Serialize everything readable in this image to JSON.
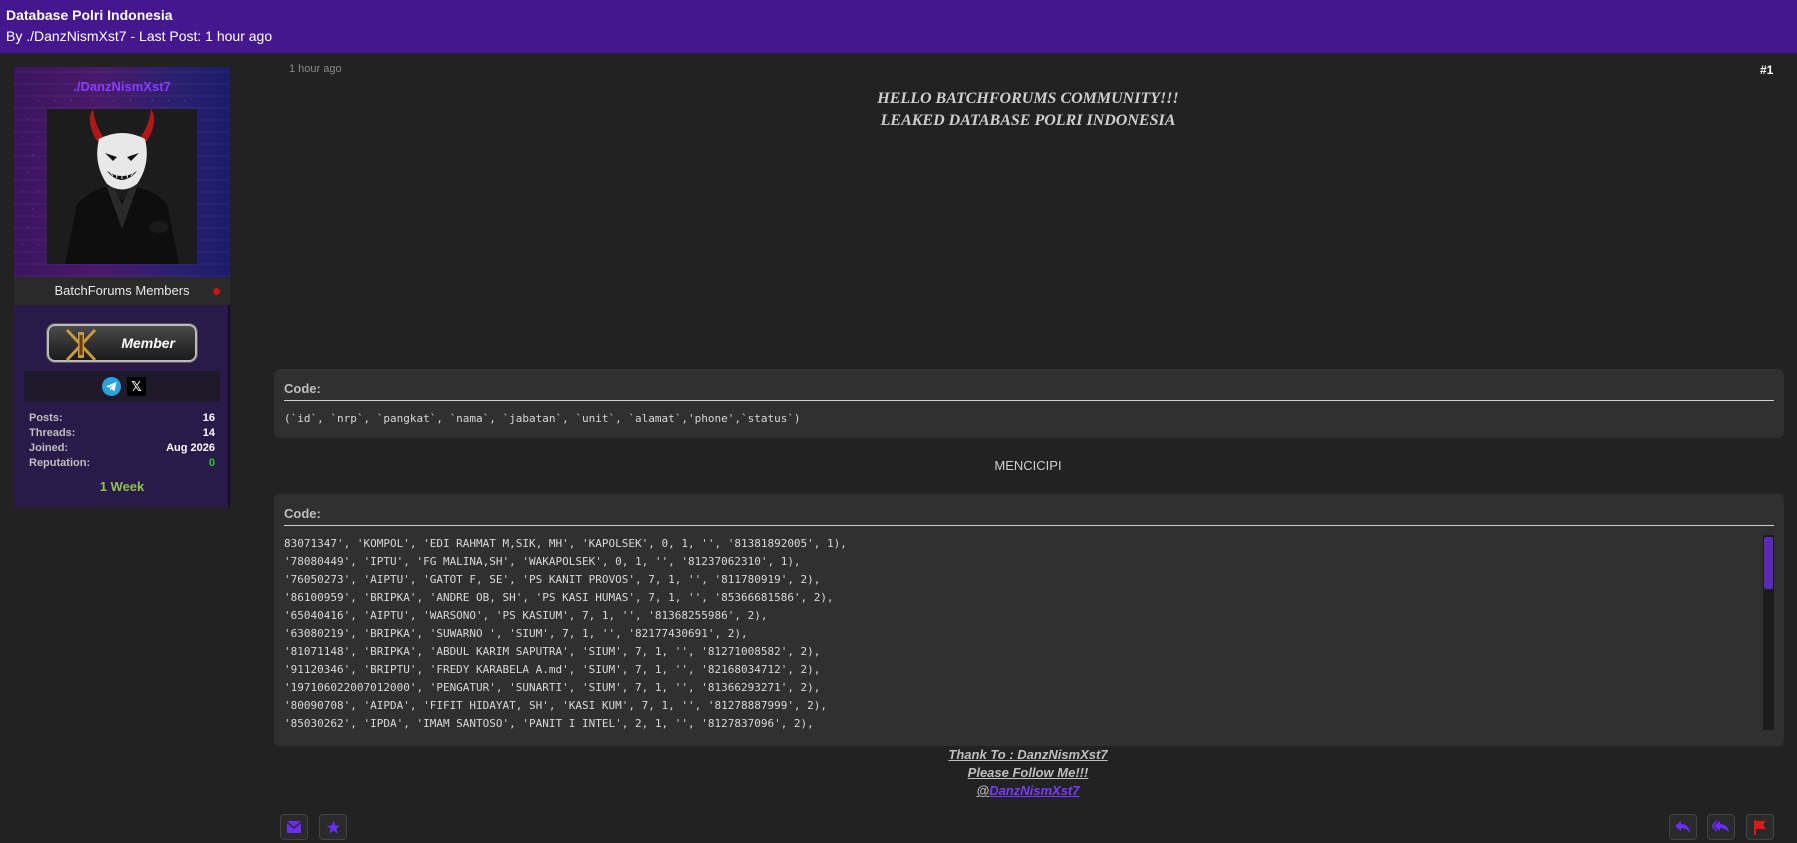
{
  "thread": {
    "title": "Database Polri Indonesia",
    "byline": "By ./DanzNismXst7 - Last Post: 1 hour ago"
  },
  "user": {
    "username": "./DanzNismXst7",
    "group": "BatchForums Members",
    "badge_label": "Member",
    "stats": [
      {
        "label": "Posts:",
        "value": "16"
      },
      {
        "label": "Threads:",
        "value": "14"
      },
      {
        "label": "Joined:",
        "value": "Aug 2026"
      },
      {
        "label": "Reputation:",
        "value": "0"
      }
    ],
    "tenure": "1 Week",
    "social": {
      "telegram_icon": "telegram-icon",
      "x_icon": "x-icon",
      "x_glyph": "𝕏"
    }
  },
  "post": {
    "timestamp": "1 hour ago",
    "number": "#1",
    "greeting": "HELLO BATCHFORUMS COMMUNITY!!!",
    "subject": "LEAKED DATABASE POLRI INDONESIA",
    "code_title": "Code:",
    "code1": "(`id`, `nrp`, `pangkat`, `nama`, `jabatan`, `unit`, `alamat`,'phone',`status`)",
    "middle_text": "MENCICIPI",
    "code2_lines": [
      "83071347', 'KOMPOL', 'EDI RAHMAT M,SIK, MH', 'KAPOLSEK', 0, 1, '', '81381892005', 1),",
      "'78080449', 'IPTU', 'FG MALINA,SH', 'WAKAPOLSEK', 0, 1, '', '81237062310', 1),",
      "'76050273', 'AIPTU', 'GATOT F, SE', 'PS KANIT PROVOS', 7, 1, '', '811780919', 2),",
      "'86100959', 'BRIPKA', 'ANDRE OB, SH', 'PS KASI HUMAS', 7, 1, '', '85366681586', 2),",
      "'65040416', 'AIPTU', 'WARSONO', 'PS KASIUM', 7, 1, '', '81368255986', 2),",
      "'63080219', 'BRIPKA', 'SUWARNO ', 'SIUM', 7, 1, '', '82177430691', 2),",
      "'81071148', 'BRIPKA', 'ABDUL KARIM SAPUTRA', 'SIUM', 7, 1, '', '81271008582', 2),",
      "'91120346', 'BRIPTU', 'FREDY KARABELA A.md', 'SIUM', 7, 1, '', '82168034712', 2),",
      "'197106022007012000', 'PENGATUR', 'SUNARTI', 'SIUM', 7, 1, '', '81366293271', 2),",
      "'80090708', 'AIPDA', 'FIFIT HIDAYAT, SH', 'KASI KUM', 7, 1, '', '81278887999', 2),",
      "'85030262', 'IPDA', 'IMAM SANTOSO', 'PANIT I INTEL', 2, 1, '', '8127837096', 2),"
    ],
    "thanks": "Thank To : DanzNismXst7",
    "follow": "Please Follow Me!!!",
    "at_sign": "@",
    "handle": "DanzNismXst7"
  },
  "actions": {
    "left": [
      "envelope-icon",
      "star-icon"
    ],
    "right": [
      "reply-icon",
      "reply-all-icon",
      "flag-icon"
    ]
  },
  "colors": {
    "header": "#45178f",
    "accent": "#7a3cff",
    "green": "#22cc22",
    "flag": "#e01818"
  }
}
